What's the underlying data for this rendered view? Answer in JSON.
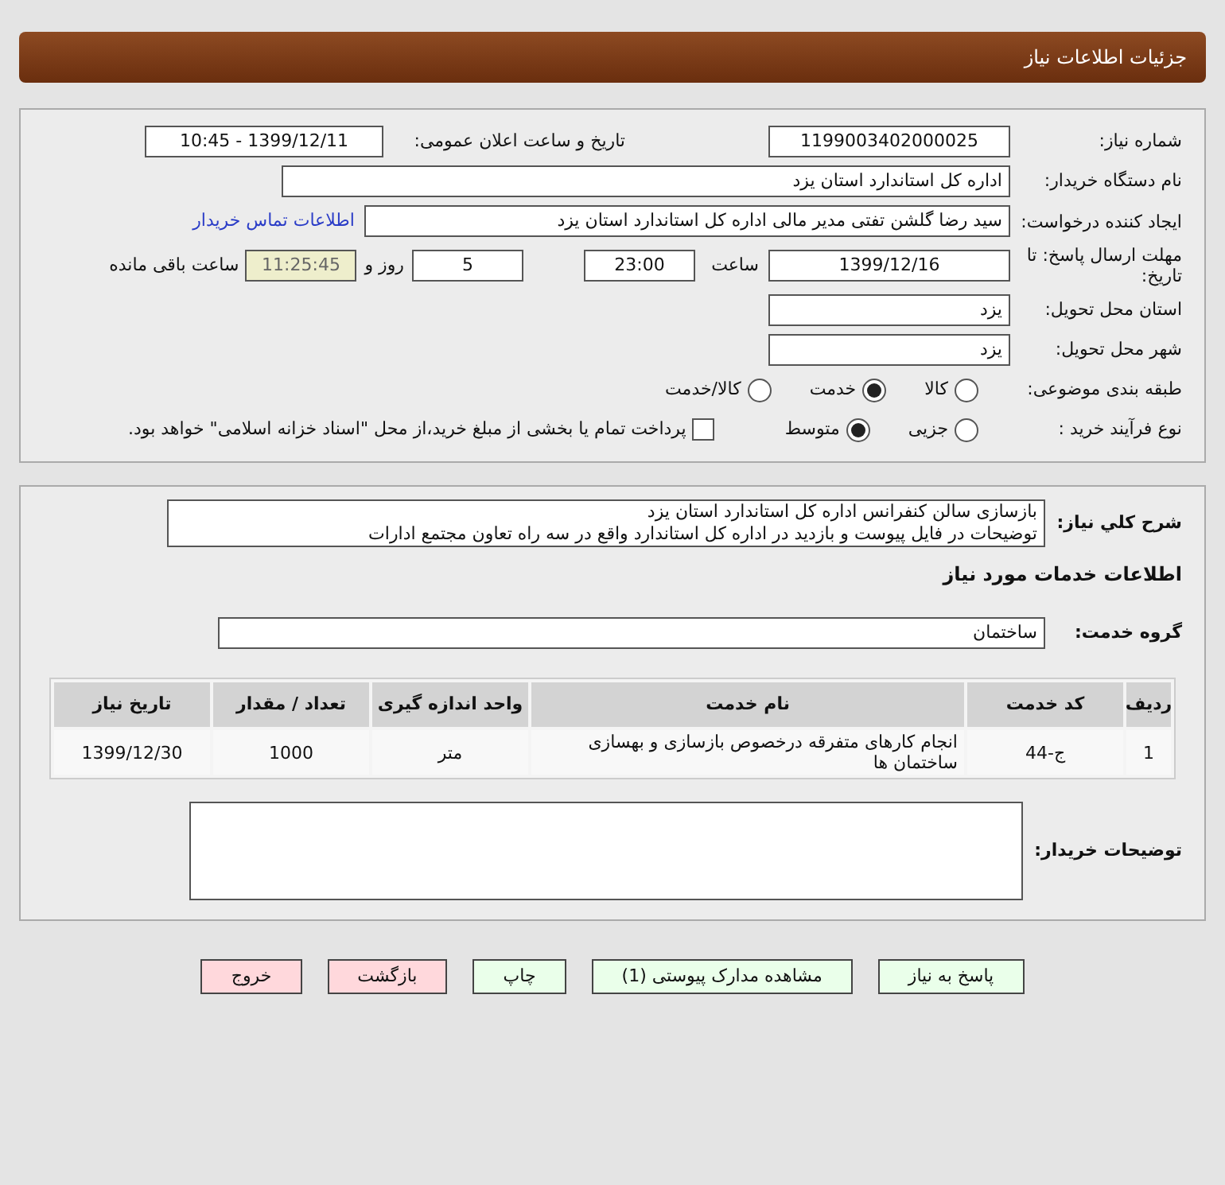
{
  "header": {
    "title": "جزئیات اطلاعات نیاز"
  },
  "details": {
    "need_number": {
      "label": "شماره نیاز:",
      "value": "1199003402000025"
    },
    "announce_date": {
      "label": "تاریخ و ساعت اعلان عمومی:",
      "value": "1399/12/11 - 10:45"
    },
    "buyer_org": {
      "label": "نام دستگاه خریدار:",
      "value": "اداره کل استاندارد استان یزد"
    },
    "requester": {
      "label": "ایجاد کننده درخواست:",
      "value": "سید رضا  گلشن تفتی مدیر مالی  اداره کل استاندارد استان یزد",
      "link": "اطلاعات تماس خریدار"
    },
    "deadline": {
      "label": "مهلت ارسال پاسخ: تا تاریخ:",
      "date": "1399/12/16",
      "time_label": "ساعت",
      "time": "23:00",
      "days": "5",
      "days_label": "روز و",
      "remaining": "11:25:45",
      "remaining_label": "ساعت باقی مانده"
    },
    "province": {
      "label": "استان محل تحویل:",
      "value": "یزد"
    },
    "city": {
      "label": "شهر محل تحویل:",
      "value": "یزد"
    },
    "category": {
      "label": "طبقه بندی موضوعی:",
      "options": [
        {
          "label": "کالا",
          "selected": false
        },
        {
          "label": "خدمت",
          "selected": true
        },
        {
          "label": "کالا/خدمت",
          "selected": false
        }
      ]
    },
    "process": {
      "label": "نوع فرآیند خرید :",
      "options": [
        {
          "label": "جزیی",
          "selected": false
        },
        {
          "label": "متوسط",
          "selected": true
        }
      ],
      "payment": {
        "label": "پرداخت تمام یا بخشی از مبلغ خرید،از محل \"اسناد خزانه اسلامی\" خواهد بود.",
        "checked": false
      }
    }
  },
  "summary": {
    "label": "شرح کلي نياز:",
    "lines": [
      "بازسازی سالن کنفرانس اداره کل استاندارد استان یزد",
      "توضیحات در فایل پیوست و بازدید در اداره کل استاندارد واقع در سه راه تعاون مجتمع ادارات"
    ]
  },
  "services": {
    "title": "اطلاعات خدمات مورد نیاز",
    "group_label": "گروه خدمت:",
    "group": "ساختمان",
    "table": {
      "columns": [
        "ردیف",
        "کد خدمت",
        "نام خدمت",
        "واحد اندازه گیری",
        "تعداد / مقدار",
        "تاریخ نیاز"
      ],
      "rows": [
        [
          "1",
          "ج-44",
          "انجام کارهای متفرقه درخصوص بازسازی و بهسازی ساختمان ها",
          "متر",
          "1000",
          "1399/12/30"
        ]
      ]
    }
  },
  "buyer_notes": {
    "label": "توضیحات خریدار:"
  },
  "buttons": [
    {
      "label": "پاسخ به نیاز",
      "kind": "action"
    },
    {
      "label": "مشاهده مدارک پیوستی (1)",
      "kind": "action"
    },
    {
      "label": "چاپ",
      "kind": "action"
    },
    {
      "label": "بازگشت",
      "kind": "exit"
    },
    {
      "label": "خروج",
      "kind": "exit"
    }
  ]
}
